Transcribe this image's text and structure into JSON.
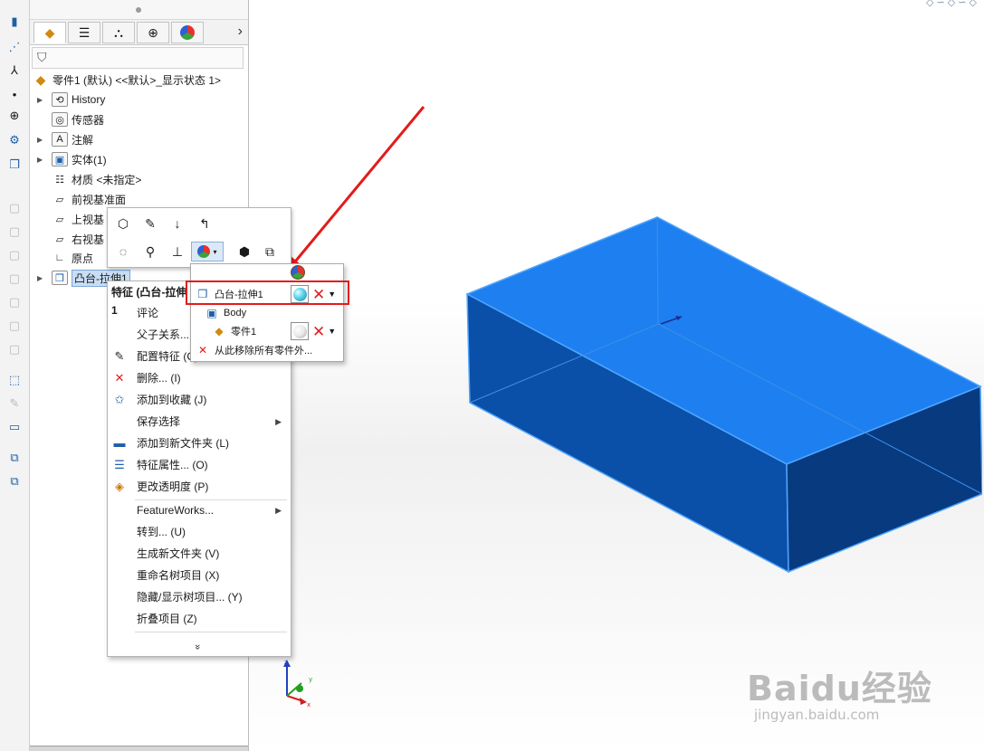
{
  "feature_tree": {
    "root_label": "零件1 (默认) <<默认>_显示状态 1>",
    "items": [
      {
        "label": "History",
        "icon": "history-icon",
        "expandable": true
      },
      {
        "label": "传感器",
        "icon": "sensor-icon",
        "expandable": false
      },
      {
        "label": "注解",
        "icon": "annotation-icon",
        "expandable": true
      },
      {
        "label": "实体(1)",
        "icon": "solid-bodies-icon",
        "expandable": true
      },
      {
        "label": "材质 <未指定>",
        "icon": "material-icon",
        "expandable": false
      },
      {
        "label": "前视基准面",
        "icon": "plane-icon",
        "expandable": false
      },
      {
        "label": "上视基",
        "icon": "plane-icon",
        "expandable": false
      },
      {
        "label": "右视基",
        "icon": "plane-icon",
        "expandable": false
      },
      {
        "label": "原点",
        "icon": "origin-icon",
        "expandable": false
      },
      {
        "label": "凸台-拉伸1",
        "icon": "extrude-icon",
        "expandable": true,
        "selected": true
      }
    ]
  },
  "context_menu": {
    "title": "特征 (凸台-拉伸1",
    "items": [
      {
        "label": "评论",
        "icon": ""
      },
      {
        "label": "父子关系...",
        "icon": ""
      },
      {
        "label": "配置特征 (C)",
        "icon": "configure-feature-icon"
      },
      {
        "label": "删除... (I)",
        "icon": "delete-icon"
      },
      {
        "label": "添加到收藏 (J)",
        "icon": "favorite-icon"
      },
      {
        "label": "保存选择",
        "icon": "",
        "submenu": true
      },
      {
        "label": "添加到新文件夹 (L)",
        "icon": "folder-icon"
      },
      {
        "label": "特征属性... (O)",
        "icon": "properties-icon"
      },
      {
        "label": "更改透明度 (P)",
        "icon": "transparency-icon"
      },
      {
        "label": "FeatureWorks...",
        "icon": "",
        "submenu": true
      },
      {
        "label": "转到... (U)",
        "icon": ""
      },
      {
        "label": "生成新文件夹 (V)",
        "icon": ""
      },
      {
        "label": "重命名树项目 (X)",
        "icon": ""
      },
      {
        "label": "隐藏/显示树项目... (Y)",
        "icon": ""
      },
      {
        "label": "折叠项目 (Z)",
        "icon": ""
      }
    ],
    "expand_glyph": "»"
  },
  "appearance_popup": {
    "rows": [
      {
        "label": "凸台-拉伸1",
        "swatch": "cyan"
      },
      {
        "label": "Body"
      },
      {
        "label": "零件1",
        "swatch": "white"
      },
      {
        "label": "从此移除所有零件外..."
      }
    ]
  },
  "watermark": {
    "brand": "Baidu经验",
    "sub": "jingyan.baidu.com"
  },
  "colors": {
    "box_top": "#1e7ff0",
    "box_front": "#0a4fa8",
    "box_side": "#083a80",
    "highlight": "#e31b1b"
  }
}
